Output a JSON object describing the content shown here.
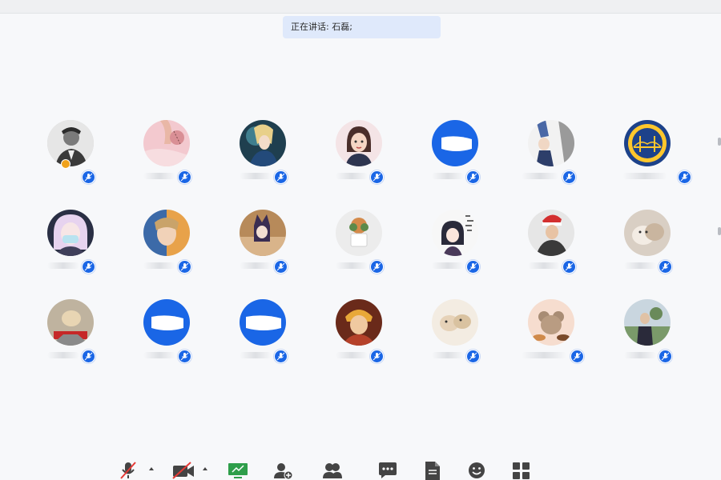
{
  "banner": {
    "speaking_text": "正在讲话: 石磊;"
  },
  "participants": [
    {
      "avatar": "man-portrait-avatar",
      "host": true
    },
    {
      "avatar": "hand-pink-avatar"
    },
    {
      "avatar": "anime-blonde-avatar"
    },
    {
      "avatar": "cartoon-girl-avatar"
    },
    {
      "avatar": "blue-default-avatar"
    },
    {
      "avatar": "figure-suit-avatar"
    },
    {
      "avatar": "bridge-logo-avatar"
    },
    {
      "avatar": "anime-masked-avatar"
    },
    {
      "avatar": "anime-fantasy-avatar"
    },
    {
      "avatar": "cat-girl-avatar"
    },
    {
      "avatar": "plant-pot-avatar"
    },
    {
      "avatar": "anime-text-avatar"
    },
    {
      "avatar": "santa-hat-man-avatar"
    },
    {
      "avatar": "cat-photo-avatar"
    },
    {
      "avatar": "dog-photo-avatar"
    },
    {
      "avatar": "blue-default-avatar"
    },
    {
      "avatar": "blue-default-avatar"
    },
    {
      "avatar": "monkey-king-avatar"
    },
    {
      "avatar": "plush-toys-avatar"
    },
    {
      "avatar": "mouse-food-avatar"
    },
    {
      "avatar": "outdoor-man-avatar"
    }
  ],
  "toolbar": {
    "items": [
      "microphone-muted-icon",
      "camera-off-icon",
      "share-screen-icon",
      "invite-icon",
      "participants-icon",
      "chat-icon",
      "document-icon",
      "emoji-icon",
      "apps-icon"
    ]
  },
  "colors": {
    "accent": "#1a66e6",
    "share_green": "#2e9e4a",
    "muted_red": "#e53935",
    "banner_bg": "#dfe9fb"
  }
}
